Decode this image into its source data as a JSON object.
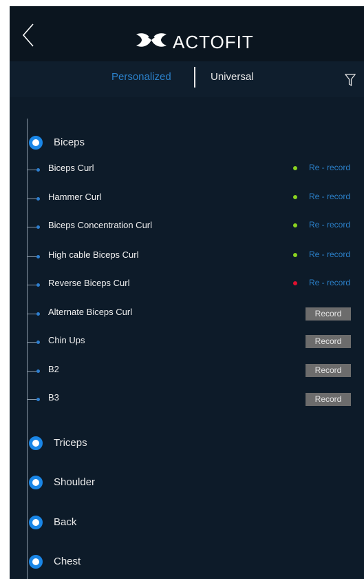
{
  "header": {
    "title": "ACTOFIT",
    "back_icon": "chevron-left-icon",
    "logo_icon": "actofit-logo-icon"
  },
  "tabs": [
    {
      "label": "Personalized",
      "active": true
    },
    {
      "label": "Universal",
      "active": false
    }
  ],
  "filter_icon": "filter-icon",
  "colors": {
    "accent": "#1a86e6",
    "link": "#2b80c9",
    "status_green": "#8ad21f",
    "status_red": "#e0102f",
    "background": "#0d1b29"
  },
  "categories": {
    "biceps": {
      "label": "Biceps",
      "exercises": [
        {
          "label": "Biceps Curl",
          "status": "green",
          "action": "Re - record"
        },
        {
          "label": "Hammer Curl",
          "status": "green",
          "action": "Re - record"
        },
        {
          "label": "Biceps Concentration Curl",
          "status": "green",
          "action": "Re - record"
        },
        {
          "label": "High cable Biceps Curl",
          "status": "green",
          "action": "Re - record"
        },
        {
          "label": "Reverse Biceps Curl",
          "status": "red",
          "action": "Re - record"
        },
        {
          "label": "Alternate Biceps Curl",
          "status": "none",
          "action": "Record"
        },
        {
          "label": "Chin Ups",
          "status": "none",
          "action": "Record"
        },
        {
          "label": "B2",
          "status": "none",
          "action": "Record"
        },
        {
          "label": "B3",
          "status": "none",
          "action": "Record"
        }
      ]
    },
    "triceps": {
      "label": "Triceps"
    },
    "shoulder": {
      "label": "Shoulder"
    },
    "back": {
      "label": "Back"
    },
    "chest": {
      "label": "Chest"
    }
  }
}
